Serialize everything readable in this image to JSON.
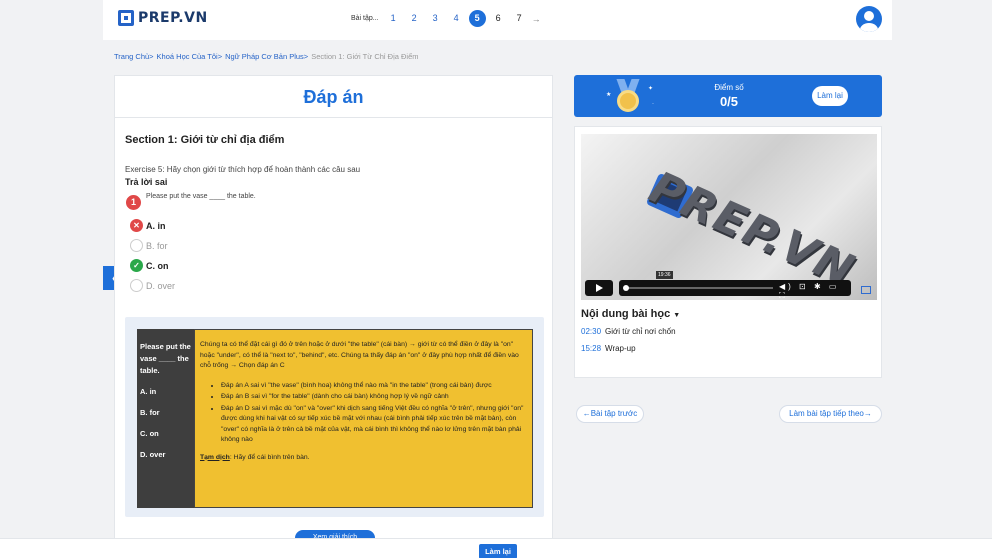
{
  "header": {
    "logo_text": "PREP.VN",
    "pager_label": "Bài tập...",
    "pages": [
      "1",
      "2",
      "3",
      "4",
      "5",
      "6",
      "7"
    ],
    "active_page": "5",
    "next_arrow": "→"
  },
  "breadcrumb": {
    "items": [
      "Trang Chủ>",
      "Khoá Học Của Tôi>",
      "Ngữ Pháp Cơ Bản Plus>"
    ],
    "current": "Section 1: Giới Từ Chỉ Địa Điểm"
  },
  "answer": {
    "title": "Đáp án",
    "section_title": "Section 1: Giới từ chỉ địa điểm",
    "exercise": "Exercise 5: Hãy chọn giới từ thích hợp để hoàn thành các câu sau",
    "result_label": "Trả lời sai",
    "question_number": "1",
    "question_text": "Please put the vase ____ the table.",
    "options": [
      {
        "label": "A. in",
        "state": "wrong"
      },
      {
        "label": "B. for",
        "state": "none"
      },
      {
        "label": "C. on",
        "state": "correct"
      },
      {
        "label": "D. over",
        "state": "none"
      }
    ],
    "side_arrow": "‹"
  },
  "explanation": {
    "left": {
      "question": "Please put the vase ____ the table.",
      "a": "A. in",
      "b": "B. for",
      "c": "C. on",
      "d": "D. over"
    },
    "intro": "Chúng ta có thể đặt cái gì đó ở trên hoặc ở dưới \"the table\" (cái bàn) → giới từ có thể điền ở đây là \"on\" hoặc \"under\", có thể là \"next to\", \"behind\", etc. Chúng ta thấy đáp án \"on\" ở đây phù hợp nhất để điền vào chỗ trống → Chọn đáp án C",
    "bullets": [
      "Đáp án A sai vì \"the vase\" (bình hoa) không thể nào mà \"in the table\" (trong cái bàn) được",
      "Đáp án B sai vì \"for the table\" (dành cho cái bàn) không hợp lý về ngữ cảnh",
      "Đáp án D sai vì mặc dù \"on\" và \"over\" khi dịch sang tiếng Việt đều có nghĩa \"ở trên\", nhưng giới \"on\" được dùng khi hai vật có sự tiếp xúc bề mặt với nhau (cái bình phải tiếp xúc trên bề mặt bàn), còn \"over\" có nghĩa là ở trên cả bề mặt của vật, mà cái bình thì không thể nào lơ lửng trên mặt bàn phải không nào"
    ],
    "translation_label": "Tạm dịch",
    "translation_text": ": Hãy để cái bình trên bàn.",
    "more_button": "Xem giải thích"
  },
  "score": {
    "label": "Điểm số",
    "value": "0/5",
    "retry_label": "Làm lại"
  },
  "video": {
    "logo": "PREP.VN",
    "time_tip": "19:36",
    "controls": "◀) ⊡ ✱ ▭ ⛶"
  },
  "content": {
    "title": "Nội dung bài học",
    "caret": "▼",
    "lessons": [
      {
        "time": "02:30",
        "title": "Giới từ chỉ nơi chốn"
      },
      {
        "time": "15:28",
        "title": "Wrap-up"
      }
    ]
  },
  "nav": {
    "prev": "←Bài tập trước",
    "next": "Làm bài tập tiếp theo→"
  },
  "bottom": {
    "retry_label": "Làm lại"
  }
}
